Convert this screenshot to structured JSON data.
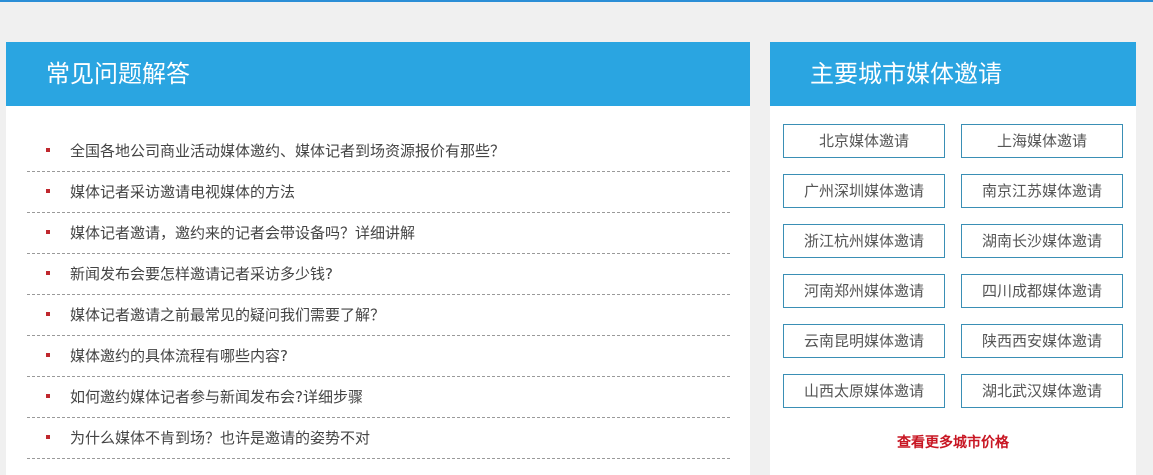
{
  "faq": {
    "title": "常见问题解答",
    "items": [
      "全国各地公司商业活动媒体邀约、媒体记者到场资源报价有那些？",
      "媒体记者采访邀请电视媒体的方法",
      "媒体记者邀请，邀约来的记者会带设备吗？详细讲解",
      "新闻发布会要怎样邀请记者采访多少钱?",
      "媒体记者邀请之前最常见的疑问我们需要了解？",
      "媒体邀约的具体流程有哪些内容?",
      "如何邀约媒体记者参与新闻发布会?详细步骤",
      "为什么媒体不肯到场？也许是邀请的姿势不对"
    ]
  },
  "cities": {
    "title": "主要城市媒体邀请",
    "buttons": [
      "北京媒体邀请",
      "上海媒体邀请",
      "广州深圳媒体邀请",
      "南京江苏媒体邀请",
      "浙江杭州媒体邀请",
      "湖南长沙媒体邀请",
      "河南郑州媒体邀请",
      "四川成都媒体邀请",
      "云南昆明媒体邀请",
      "陕西西安媒体邀请",
      "山西太原媒体邀请",
      "湖北武汉媒体邀请"
    ],
    "more_link": "查看更多城市价格"
  },
  "colors": {
    "header_bg": "#2aa5e1",
    "bullet": "#c0282e",
    "more_link": "#c81623",
    "button_border": "#3a8fb5"
  }
}
